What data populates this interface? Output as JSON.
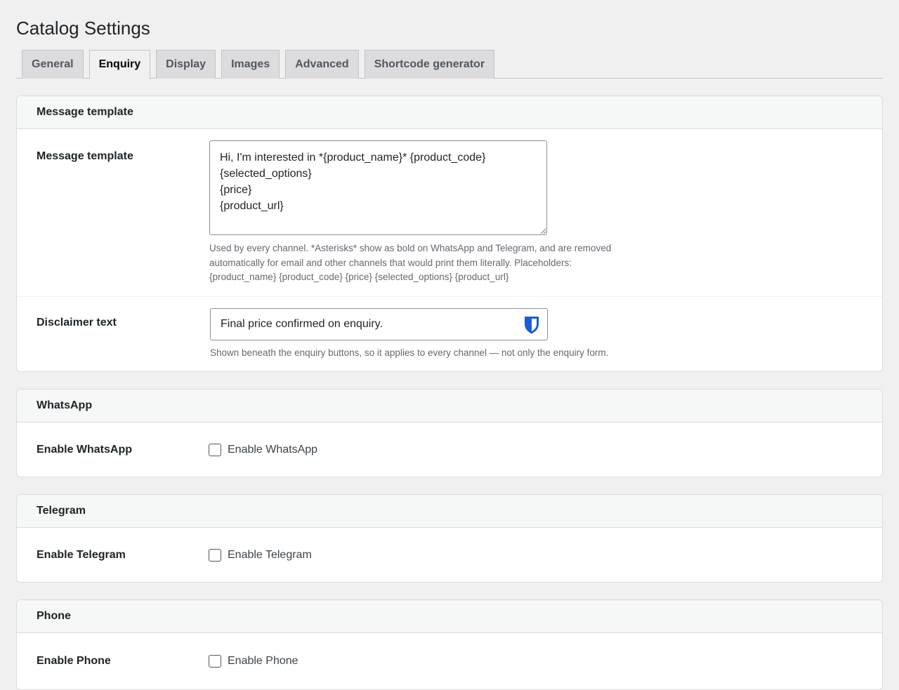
{
  "page": {
    "title": "Catalog Settings"
  },
  "tabs": [
    {
      "label": "General",
      "active": false
    },
    {
      "label": "Enquiry",
      "active": true
    },
    {
      "label": "Display",
      "active": false
    },
    {
      "label": "Images",
      "active": false
    },
    {
      "label": "Advanced",
      "active": false
    },
    {
      "label": "Shortcode generator",
      "active": false
    }
  ],
  "message_section": {
    "heading": "Message template",
    "template_label": "Message template",
    "template_value": "Hi, I'm interested in *{product_name}* {product_code}\n{selected_options}\n{price}\n{product_url}",
    "template_help": "Used by every channel. *Asterisks* show as bold on WhatsApp and Telegram, and are removed automatically for email and other channels that would print them literally. Placeholders: {product_name} {product_code} {price} {selected_options} {product_url}",
    "disclaimer_label": "Disclaimer text",
    "disclaimer_value": "Final price confirmed on enquiry.",
    "disclaimer_help": "Shown beneath the enquiry buttons, so it applies to every channel — not only the enquiry form.",
    "password_manager_icon": "shield-icon"
  },
  "whatsapp": {
    "heading": "WhatsApp",
    "label": "Enable WhatsApp",
    "checkbox_label": "Enable WhatsApp",
    "checked": false
  },
  "telegram": {
    "heading": "Telegram",
    "label": "Enable Telegram",
    "checkbox_label": "Enable Telegram",
    "checked": false
  },
  "phone": {
    "heading": "Phone",
    "label": "Enable Phone",
    "checkbox_label": "Enable Phone",
    "checked": false
  },
  "colors": {
    "background": "#f0f0f1",
    "card": "#ffffff",
    "tab_inactive": "#dcdcde",
    "shield_blue": "#175ddc"
  }
}
